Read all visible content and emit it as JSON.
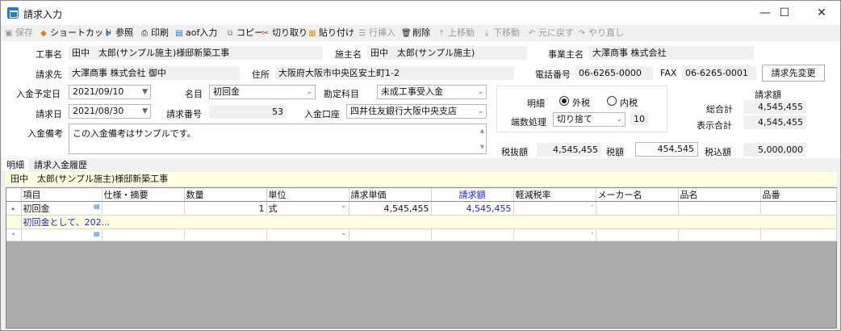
{
  "window": {
    "title": "請求入力",
    "minimize": "—",
    "maximize": "☐",
    "close": "✕"
  },
  "toolbar": {
    "save": "保存",
    "shortcut": "ショートカット",
    "reference": "参照",
    "print": "印刷",
    "aof_input": "aof入力",
    "copy": "コピー",
    "cut": "切り取り",
    "paste": "貼り付け",
    "insert_row": "行挿入",
    "delete": "削除",
    "move_up": "上移動",
    "move_down": "下移動",
    "undo": "元に戻す",
    "redo": "やり直し"
  },
  "form": {
    "work_name_label": "工事名",
    "work_name": "田中　太郎(サンプル施主)様邸新築工事",
    "owner_label": "施主名",
    "owner": "田中　太郎(サンプル施主)",
    "business_owner_label": "事業主名",
    "business_owner": "大澤商事 株式会社",
    "billing_to_label": "請求先",
    "billing_to": "大澤商事 株式会社 御中",
    "address_label": "住所",
    "address": "大阪府大阪市中央区安土町1-2",
    "phone_label": "電話番号",
    "phone": "06-6265-0000",
    "fax_label": "FAX",
    "fax": "06-6265-0001",
    "change_billing_button": "請求先変更",
    "deposit_date_label": "入金予定日",
    "deposit_date": "2021/09/10",
    "item_name_label": "名目",
    "item_name": "初回金",
    "account_label": "勘定科目",
    "account": "未成工事受入金",
    "billing_date_label": "請求日",
    "billing_date": "2021/08/30",
    "billing_no_label": "請求番号",
    "billing_no": "53",
    "deposit_account_label": "入金口座",
    "deposit_account": "四井住友銀行大阪中央支店",
    "note_label": "入金備考",
    "note": "この入金備考はサンプルです。",
    "detail_label": "明細",
    "tax_excl": "外税",
    "tax_incl": "内税",
    "rounding_label": "端数処理",
    "rounding": "切り捨て",
    "rounding_digits": "10",
    "billing_amount_label": "請求額",
    "grand_total_label": "総合計",
    "grand_total": "4,545,455",
    "display_total_label": "表示合計",
    "display_total": "4,545,455",
    "pre_tax_label": "税抜額",
    "pre_tax": "4,545,455",
    "tax_label": "税額",
    "tax": "454,545",
    "incl_tax_label": "税込額",
    "incl_tax": "5,000,000"
  },
  "tabs": [
    "明細",
    "請求入金履歴"
  ],
  "banner": "田中　太郎(サンプル施主)様邸新築工事",
  "table": {
    "columns": [
      "項目",
      "仕様・摘要",
      "数量",
      "単位",
      "請求単価",
      "請求額",
      "軽減税率",
      "メーカー名",
      "品名",
      "品番"
    ],
    "row1": {
      "item": "初回金",
      "qty": "1",
      "unit": "式",
      "unit_price": "4,545,455",
      "amount": "4,545,455",
      "reduced": "-"
    },
    "row1_sub": "初回金として、202...",
    "row2": {
      "reduced": "-"
    }
  },
  "icons": [
    "save-icon",
    "shortcut-icon",
    "reference-icon",
    "print-icon",
    "aof-icon",
    "copy-icon",
    "cut-icon",
    "paste-icon",
    "insert-row-icon",
    "delete-icon",
    "move-up-icon",
    "move-down-icon",
    "undo-icon",
    "redo-icon"
  ]
}
